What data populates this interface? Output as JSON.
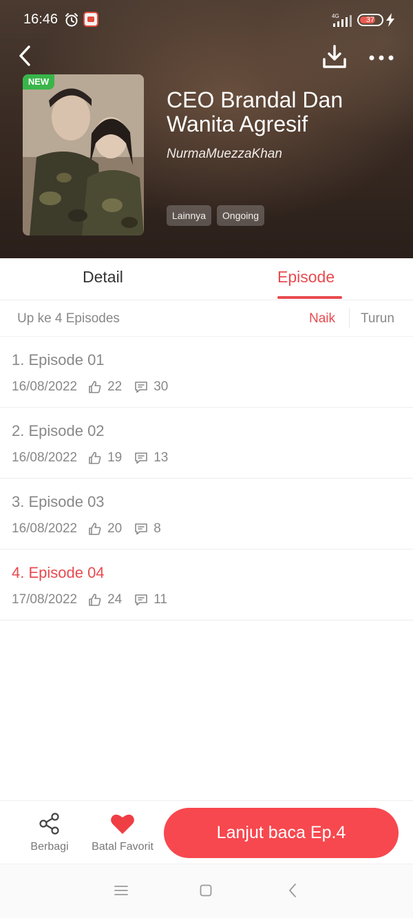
{
  "status_bar": {
    "time": "16:46",
    "network": "4G",
    "battery_level": "37",
    "alarm_icon": "alarm-clock-icon",
    "app_icon": "app-notification-icon",
    "signal_icon": "signal-strength-icon",
    "charging_icon": "lightning-bolt-icon"
  },
  "header": {
    "back_icon": "chevron-left-icon",
    "download_icon": "download-icon",
    "more_icon": "more-dots-icon",
    "cover_badge": "NEW",
    "title": "CEO Brandal Dan Wanita Agresif",
    "author": "NurmaMuezzaKhan",
    "tags": [
      "Lainnya",
      "Ongoing"
    ]
  },
  "tabs": {
    "detail_label": "Detail",
    "episode_label": "Episode",
    "active": "Episode"
  },
  "sort": {
    "count_label": "Up ke 4 Episodes",
    "asc_label": "Naik",
    "desc_label": "Turun",
    "active": "Naik"
  },
  "episodes": [
    {
      "title": "1. Episode 01",
      "date": "16/08/2022",
      "likes": "22",
      "comments": "30",
      "current": false
    },
    {
      "title": "2. Episode 02",
      "date": "16/08/2022",
      "likes": "19",
      "comments": "13",
      "current": false
    },
    {
      "title": "3. Episode 03",
      "date": "16/08/2022",
      "likes": "20",
      "comments": "8",
      "current": false
    },
    {
      "title": "4. Episode 04",
      "date": "17/08/2022",
      "likes": "24",
      "comments": "11",
      "current": true
    }
  ],
  "actions": {
    "share_label": "Berbagi",
    "share_icon": "share-icon",
    "favorite_label": "Batal Favorit",
    "favorite_icon": "heart-icon",
    "continue_label": "Lanjut baca Ep.4"
  },
  "colors": {
    "accent": "#e84a4f",
    "button": "#f7484f",
    "badge_green": "#39b54a",
    "muted_text": "#888888"
  }
}
